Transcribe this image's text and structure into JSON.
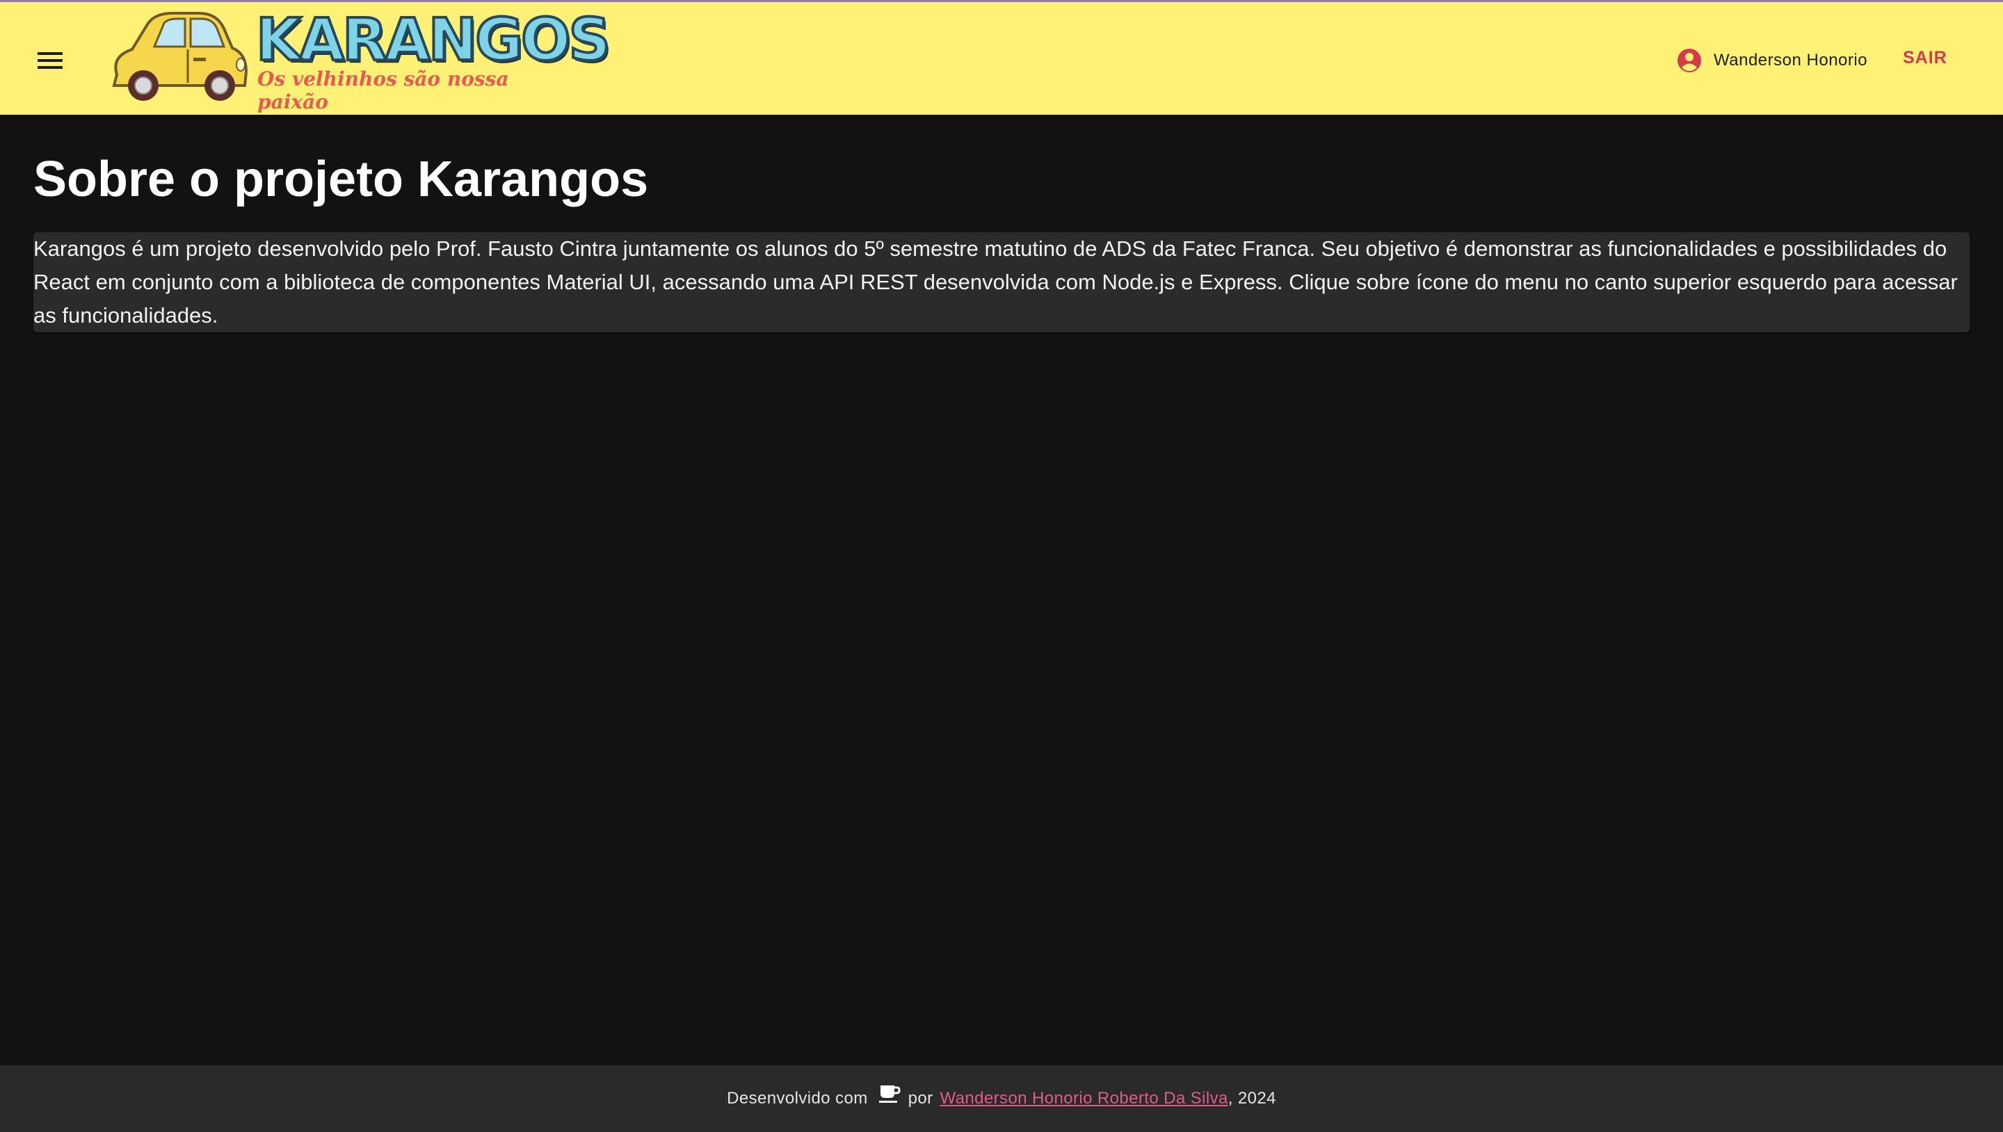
{
  "header": {
    "logo_title": "KARANGOS",
    "logo_subtitle": "Os velhinhos são nossa paixão",
    "user_name": "Wanderson Honorio",
    "logout_label": "SAIR"
  },
  "main": {
    "title": "Sobre o projeto Karangos",
    "description": "Karangos é um projeto desenvolvido pelo Prof. Fausto Cintra juntamente os alunos do 5º semestre matutino de ADS da Fatec Franca. Seu objetivo é demonstrar as funcionalidades e possibilidades do React em conjunto com a biblioteca de componentes Material UI, acessando uma API REST desenvolvida com Node.js e Express. Clique sobre ícone do menu no canto superior esquerdo para acessar as funcionalidades."
  },
  "footer": {
    "prefix": "Desenvolvido com",
    "by": "por",
    "author_link": "Wanderson Honorio Roberto Da Silva",
    "suffix": ", 2024"
  },
  "colors": {
    "appbar_bg": "#fff176",
    "accent": "#d63a4a",
    "link": "#e25b8c",
    "background": "#121212",
    "paper": "#2b2b2b"
  },
  "icons": {
    "menu": "menu-icon",
    "user": "account-circle-icon",
    "footer": "coffee-icon",
    "logo": "car-logo-icon"
  }
}
